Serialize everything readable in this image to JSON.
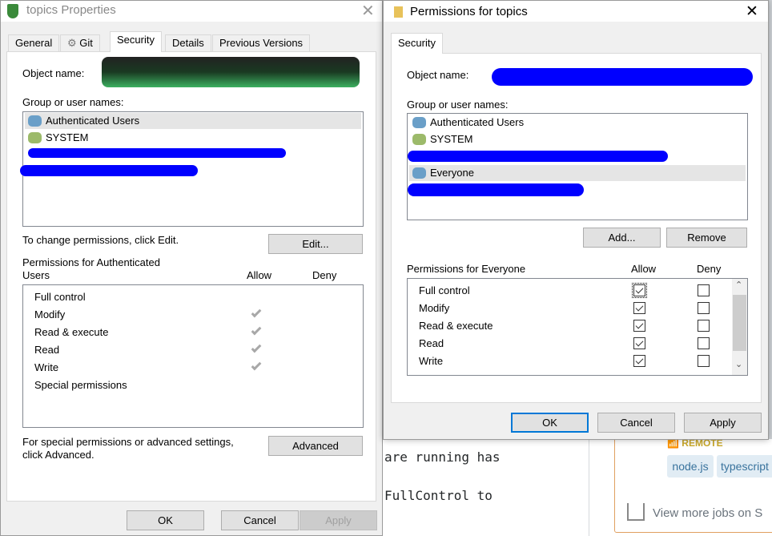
{
  "background": {
    "line1": "are running has",
    "line2": "FullControl to",
    "remote": "REMOTE",
    "tags": [
      "node.js",
      "typescript"
    ],
    "jobs_link": "View more jobs on S"
  },
  "props": {
    "title": "topics Properties",
    "tabs": [
      "General",
      "Git",
      "Security",
      "Details",
      "Previous Versions"
    ],
    "object_label": "Object name:",
    "group_label": "Group or user names:",
    "users": [
      "Authenticated Users",
      "SYSTEM"
    ],
    "change_text": "To change permissions, click Edit.",
    "edit": "Edit...",
    "perm_label": "Permissions for Authenticated Users",
    "perm_label_1": "Permissions for Authenticated",
    "perm_label_2": "Users",
    "allow": "Allow",
    "deny": "Deny",
    "perms": [
      {
        "name": "Full control",
        "allow": false
      },
      {
        "name": "Modify",
        "allow": true
      },
      {
        "name": "Read & execute",
        "allow": true
      },
      {
        "name": "Read",
        "allow": true
      },
      {
        "name": "Write",
        "allow": true
      },
      {
        "name": "Special permissions",
        "allow": false
      }
    ],
    "special_1": "For special permissions or advanced settings,",
    "special_2": "click Advanced.",
    "advanced": "Advanced",
    "ok": "OK",
    "cancel": "Cancel",
    "apply": "Apply"
  },
  "perm": {
    "title": "Permissions for topics",
    "tab": "Security",
    "object_label": "Object name:",
    "group_label": "Group or user names:",
    "users": [
      "Authenticated Users",
      "SYSTEM",
      "Everyone"
    ],
    "selected": "Everyone",
    "add": "Add...",
    "remove": "Remove",
    "perm_label": "Permissions for Everyone",
    "allow": "Allow",
    "deny": "Deny",
    "perms": [
      {
        "name": "Full control",
        "allow": true,
        "deny": false
      },
      {
        "name": "Modify",
        "allow": true,
        "deny": false
      },
      {
        "name": "Read & execute",
        "allow": true,
        "deny": false
      },
      {
        "name": "Read",
        "allow": true,
        "deny": false
      },
      {
        "name": "Write",
        "allow": true,
        "deny": false
      }
    ],
    "ok": "OK",
    "cancel": "Cancel",
    "apply": "Apply"
  },
  "colors": {
    "accent": "#0078d7",
    "redact_blue": "#0000ff",
    "remote": "#c9a82a",
    "card_border": "#e0a060"
  }
}
